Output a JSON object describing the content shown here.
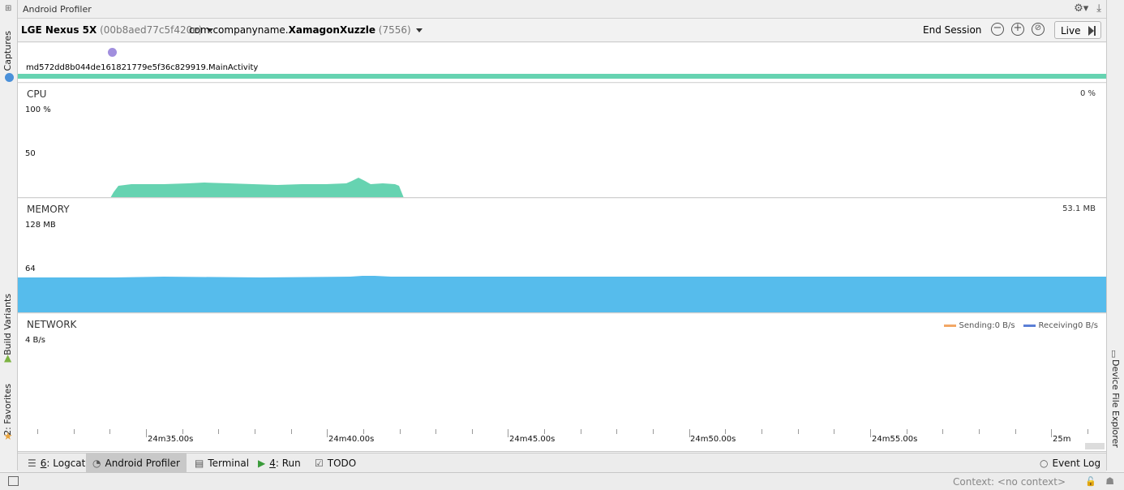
{
  "window": {
    "title": "Android Profiler"
  },
  "side_tabs": {
    "captures": "Captures",
    "build_variants": "Build Variants",
    "favorites": "2: Favorites",
    "device_file_explorer": "Device File Explorer"
  },
  "session": {
    "device_name": "LGE Nexus 5X",
    "device_serial": "(00b8aed77c5f420e)",
    "process_prefix": "com.companyname.",
    "process_name": "XamagonXuzzle",
    "process_pid": "(7556)",
    "end_session_label": "End Session",
    "live_label": "Live"
  },
  "events": {
    "activity_name": "md572dd8b044de161821779e5f36c829919.MainActivity"
  },
  "cpu": {
    "label": "CPU",
    "current": "0 %",
    "axis_top": "100 %",
    "axis_mid": "50",
    "fill_color": "#66d3b1"
  },
  "memory": {
    "label": "MEMORY",
    "current": "53.1 MB",
    "axis_top": "128 MB",
    "axis_mid": "64",
    "fill_color": "#56bcec"
  },
  "network": {
    "label": "NETWORK",
    "axis_top": "4 B/s",
    "sending_label": "Sending:0 B/s",
    "receiving_label": "Receiving0 B/s",
    "sending_color": "#f2a765",
    "receiving_color": "#5b7fd6"
  },
  "timeline": {
    "labels": [
      "24m35.00s",
      "24m40.00s",
      "24m45.00s",
      "24m50.00s",
      "24m55.00s",
      "25m"
    ]
  },
  "tool_windows": {
    "logcat_num": "6",
    "logcat": ": Logcat",
    "profiler": "Android Profiler",
    "terminal": "Terminal",
    "run_num": "4",
    "run": ": Run",
    "todo": "TODO",
    "event_log": "Event Log"
  },
  "status": {
    "context": "Context: <no context>"
  }
}
